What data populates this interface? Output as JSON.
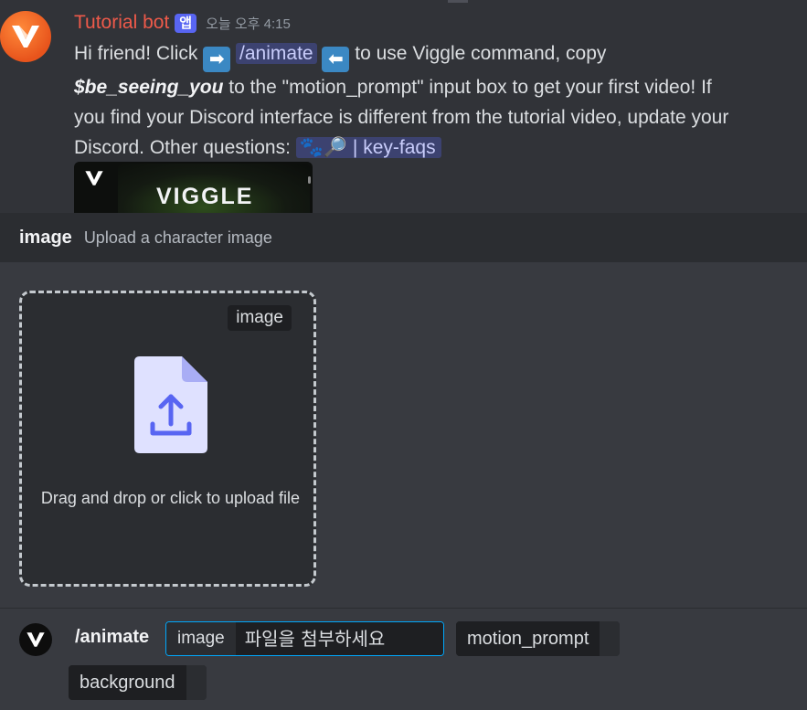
{
  "message": {
    "author": "Tutorial bot",
    "app_badge": "앱",
    "timestamp": "오늘 오후 4:15",
    "body": {
      "t1": "Hi friend! Click ",
      "arrow_right": "➡",
      "command_mention": "/animate",
      "arrow_left": "⬅",
      "t2": " to use Viggle command, copy ",
      "code_phrase": "$be_seeing_you",
      "t3": " to the \"motion_prompt\" input box to get your first video! If you find your Discord interface is different from the tutorial video, update your Discord. Other questions: ",
      "channel_mention": "🐾🔎 | key-faqs"
    },
    "embed": {
      "title": "VIGGLE"
    }
  },
  "option": {
    "name": "image",
    "description": "Upload a character image"
  },
  "dropzone": {
    "tag": "image",
    "text": "Drag and drop or click to upload file"
  },
  "command_bar": {
    "command": "/animate",
    "active_field": {
      "label": "image",
      "placeholder": "파일을 첨부하세요"
    },
    "chips": [
      "motion_prompt",
      "background"
    ]
  },
  "colors": {
    "author": "#ef5a4a",
    "app_badge": "#5865f2",
    "mention_bg": "#3c4270",
    "focus_border": "#00a8fc"
  },
  "icons": [
    "viggle-logo-icon",
    "file-upload-icon",
    "arrow-right-icon",
    "arrow-left-icon"
  ]
}
